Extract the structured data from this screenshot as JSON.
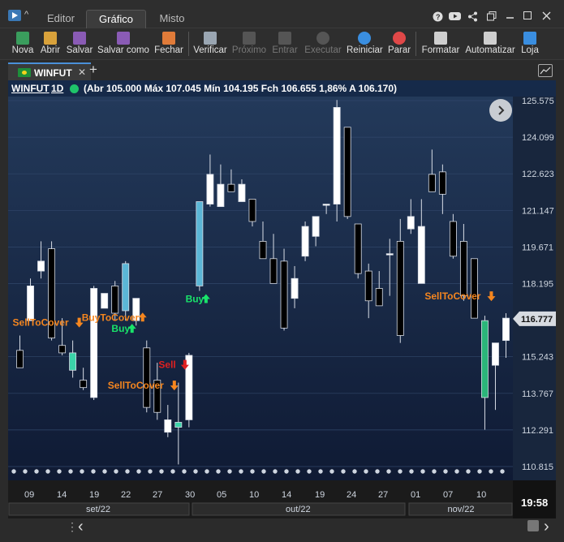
{
  "title_tabs": [
    {
      "label": "Editor",
      "active": false
    },
    {
      "label": "Gráfico",
      "active": true
    },
    {
      "label": "Misto",
      "active": false
    }
  ],
  "window_controls": [
    "help-icon",
    "youtube-icon",
    "share-icon",
    "restore-icon",
    "minimize-icon",
    "maximize-icon",
    "close-icon"
  ],
  "toolbar": [
    {
      "label": "Nova",
      "icon": "new-icon",
      "color": "#3a9d5d",
      "enabled": true
    },
    {
      "label": "Abrir",
      "icon": "open-icon",
      "color": "#d9a23b",
      "enabled": true
    },
    {
      "label": "Salvar",
      "icon": "save-icon",
      "color": "#8a5bb5",
      "enabled": true
    },
    {
      "label": "Salvar como",
      "icon": "save-as-icon",
      "color": "#8a5bb5",
      "enabled": true
    },
    {
      "label": "Fechar",
      "icon": "close-file-icon",
      "color": "#e07b39",
      "enabled": true
    },
    {
      "label": "Verificar",
      "icon": "verify-icon",
      "color": "#9aa6b2",
      "enabled": true
    },
    {
      "label": "Próximo",
      "icon": "next-icon",
      "color": "#555",
      "enabled": false
    },
    {
      "label": "Entrar",
      "icon": "enter-icon",
      "color": "#555",
      "enabled": false
    },
    {
      "label": "Executar",
      "icon": "execute-icon",
      "color": "#555",
      "enabled": false
    },
    {
      "label": "Reiniciar",
      "icon": "restart-icon",
      "color": "#3a8ee0",
      "enabled": true
    },
    {
      "label": "Parar",
      "icon": "stop-icon",
      "color": "#e04848",
      "enabled": true
    },
    {
      "label": "Formatar",
      "icon": "format-icon",
      "color": "#cfcfcf",
      "enabled": true
    },
    {
      "label": "Automatizar",
      "icon": "automate-icon",
      "color": "#cfcfcf",
      "enabled": true
    },
    {
      "label": "Loja",
      "icon": "store-icon",
      "color": "#3a8ee0",
      "enabled": true
    }
  ],
  "chart_tab": {
    "label": "WINFUT",
    "add": "+"
  },
  "info": {
    "symbol": "WINFUT",
    "interval": "1D",
    "ohlc": "(Abr 105.000 Máx 107.045 Mín 104.195 Fch 106.655 1,86% A 106.170)"
  },
  "chart_data": {
    "type": "candlestick",
    "y_ticks": [
      "125.575",
      "124.099",
      "122.623",
      "121.147",
      "119.671",
      "118.195",
      "115.243",
      "113.767",
      "112.291",
      "110.815"
    ],
    "ylim": [
      110.815,
      125.575
    ],
    "last_price": "116.777",
    "x_ticks": [
      "09",
      "14",
      "19",
      "22",
      "27",
      "30",
      "05",
      "10",
      "14",
      "19",
      "24",
      "27",
      "01",
      "07",
      "10"
    ],
    "months": [
      "set/22",
      "out/22",
      "nov/22"
    ],
    "signals": [
      {
        "label": "SellToCover",
        "color": "#f5861f"
      },
      {
        "label": "Buy",
        "color": "#19e36a"
      },
      {
        "label": "BuyToCover",
        "color": "#f5861f"
      },
      {
        "label": "SellToCover",
        "color": "#f5861f"
      },
      {
        "label": "Sell",
        "color": "#e02020"
      },
      {
        "label": "Buy",
        "color": "#19e36a"
      },
      {
        "label": "SellToCover",
        "color": "#f5861f"
      }
    ],
    "candles": [
      {
        "o": 115.5,
        "h": 116.1,
        "l": 114.8,
        "c": 114.8
      },
      {
        "o": 116.7,
        "h": 118.4,
        "l": 116.7,
        "c": 118.1
      },
      {
        "o": 118.7,
        "h": 119.9,
        "l": 118.4,
        "c": 119.1
      },
      {
        "o": 119.6,
        "h": 119.9,
        "l": 115.9,
        "c": 116.0
      },
      {
        "o": 115.7,
        "h": 116.8,
        "l": 115.3,
        "c": 115.4
      },
      {
        "o": 115.4,
        "h": 115.9,
        "l": 114.4,
        "c": 114.7
      },
      {
        "o": 114.3,
        "h": 114.8,
        "l": 113.9,
        "c": 114.0
      },
      {
        "o": 113.6,
        "h": 118.1,
        "l": 113.5,
        "c": 118.0
      },
      {
        "o": 117.2,
        "h": 117.8,
        "l": 117.2,
        "c": 117.8
      },
      {
        "o": 118.1,
        "h": 118.3,
        "l": 116.7,
        "c": 117.0
      },
      {
        "o": 117.1,
        "h": 119.1,
        "l": 116.7,
        "c": 119.0
      },
      {
        "o": 116.7,
        "h": 117.6,
        "l": 116.5,
        "c": 117.6
      },
      {
        "o": 115.6,
        "h": 115.9,
        "l": 113.0,
        "c": 113.2
      },
      {
        "o": 114.3,
        "h": 115.0,
        "l": 112.7,
        "c": 113.0
      },
      {
        "o": 112.2,
        "h": 113.3,
        "l": 112.0,
        "c": 112.7
      },
      {
        "o": 112.6,
        "h": 114.2,
        "l": 110.9,
        "c": 112.4
      },
      {
        "o": 112.7,
        "h": 115.4,
        "l": 112.4,
        "c": 115.3
      },
      {
        "o": 118.1,
        "h": 121.5,
        "l": 117.9,
        "c": 121.5
      },
      {
        "o": 121.4,
        "h": 123.4,
        "l": 121.3,
        "c": 122.6
      },
      {
        "o": 121.3,
        "h": 123.0,
        "l": 121.3,
        "c": 122.2
      },
      {
        "o": 122.2,
        "h": 122.8,
        "l": 121.9,
        "c": 121.9
      },
      {
        "o": 121.5,
        "h": 122.4,
        "l": 121.5,
        "c": 122.2
      },
      {
        "o": 121.6,
        "h": 121.6,
        "l": 120.5,
        "c": 120.7
      },
      {
        "o": 119.9,
        "h": 120.7,
        "l": 119.2,
        "c": 119.2
      },
      {
        "o": 119.2,
        "h": 120.2,
        "l": 118.2,
        "c": 118.2
      },
      {
        "o": 119.1,
        "h": 119.6,
        "l": 116.3,
        "c": 116.4
      },
      {
        "o": 117.6,
        "h": 118.9,
        "l": 117.2,
        "c": 118.4
      },
      {
        "o": 119.3,
        "h": 120.7,
        "l": 119.1,
        "c": 120.5
      },
      {
        "o": 120.1,
        "h": 120.8,
        "l": 119.7,
        "c": 120.9
      },
      {
        "o": 121.4,
        "h": 121.4,
        "l": 121.0,
        "c": 121.4
      },
      {
        "o": 121.4,
        "h": 125.6,
        "l": 120.7,
        "c": 125.3
      },
      {
        "o": 124.5,
        "h": 124.5,
        "l": 120.8,
        "c": 120.9
      },
      {
        "o": 120.6,
        "h": 120.6,
        "l": 118.4,
        "c": 118.6
      },
      {
        "o": 118.7,
        "h": 119.0,
        "l": 116.8,
        "c": 117.5
      },
      {
        "o": 118.0,
        "h": 118.7,
        "l": 117.3,
        "c": 117.3
      },
      {
        "o": 119.4,
        "h": 120.0,
        "l": 117.7,
        "c": 119.4
      },
      {
        "o": 119.9,
        "h": 120.8,
        "l": 115.8,
        "c": 116.1
      },
      {
        "o": 120.4,
        "h": 121.6,
        "l": 120.2,
        "c": 120.9
      },
      {
        "o": 118.2,
        "h": 121.6,
        "l": 118.2,
        "c": 120.5
      },
      {
        "o": 122.6,
        "h": 123.6,
        "l": 122.0,
        "c": 121.9
      },
      {
        "o": 122.7,
        "h": 123.0,
        "l": 121.0,
        "c": 121.8
      },
      {
        "o": 120.7,
        "h": 121.0,
        "l": 119.2,
        "c": 119.3
      },
      {
        "o": 119.9,
        "h": 120.6,
        "l": 117.5,
        "c": 117.7
      },
      {
        "o": 119.2,
        "h": 119.2,
        "l": 116.8,
        "c": 116.8
      },
      {
        "o": 116.7,
        "h": 116.9,
        "l": 112.3,
        "c": 113.6
      },
      {
        "o": 114.9,
        "h": 115.8,
        "l": 113.1,
        "c": 115.8
      },
      {
        "o": 115.9,
        "h": 117.0,
        "l": 115.2,
        "c": 116.8
      }
    ]
  },
  "clock": "19:58",
  "nav": {
    "left": "‹",
    "right": "›",
    "more": "⋮"
  }
}
